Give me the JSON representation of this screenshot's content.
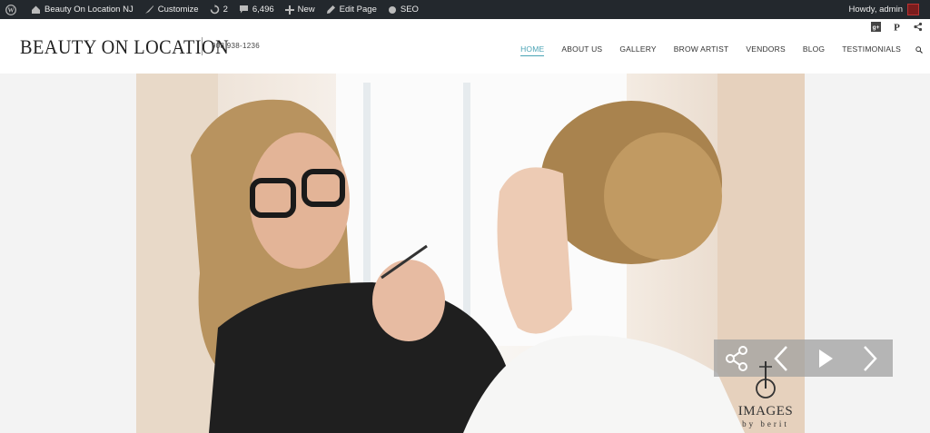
{
  "adminbar": {
    "site_name": "Beauty On Location NJ",
    "customize": "Customize",
    "updates": "2",
    "comments": "6,496",
    "new": "New",
    "edit_page": "Edit Page",
    "seo": "SEO",
    "howdy": "Howdy, admin"
  },
  "header": {
    "logo": "BEAUTY ON LOCATION",
    "phone": "908 938-1236",
    "nav": [
      "HOME",
      "ABOUT US",
      "GALLERY",
      "BROW ARTIST",
      "VENDORS",
      "BLOG",
      "TESTIMONIALS"
    ],
    "active_nav": "HOME"
  },
  "watermark": {
    "line1": "IMAGES",
    "line2": "by berit"
  },
  "colors": {
    "adminbar": "#23282d",
    "accent": "#4aa3b5"
  }
}
